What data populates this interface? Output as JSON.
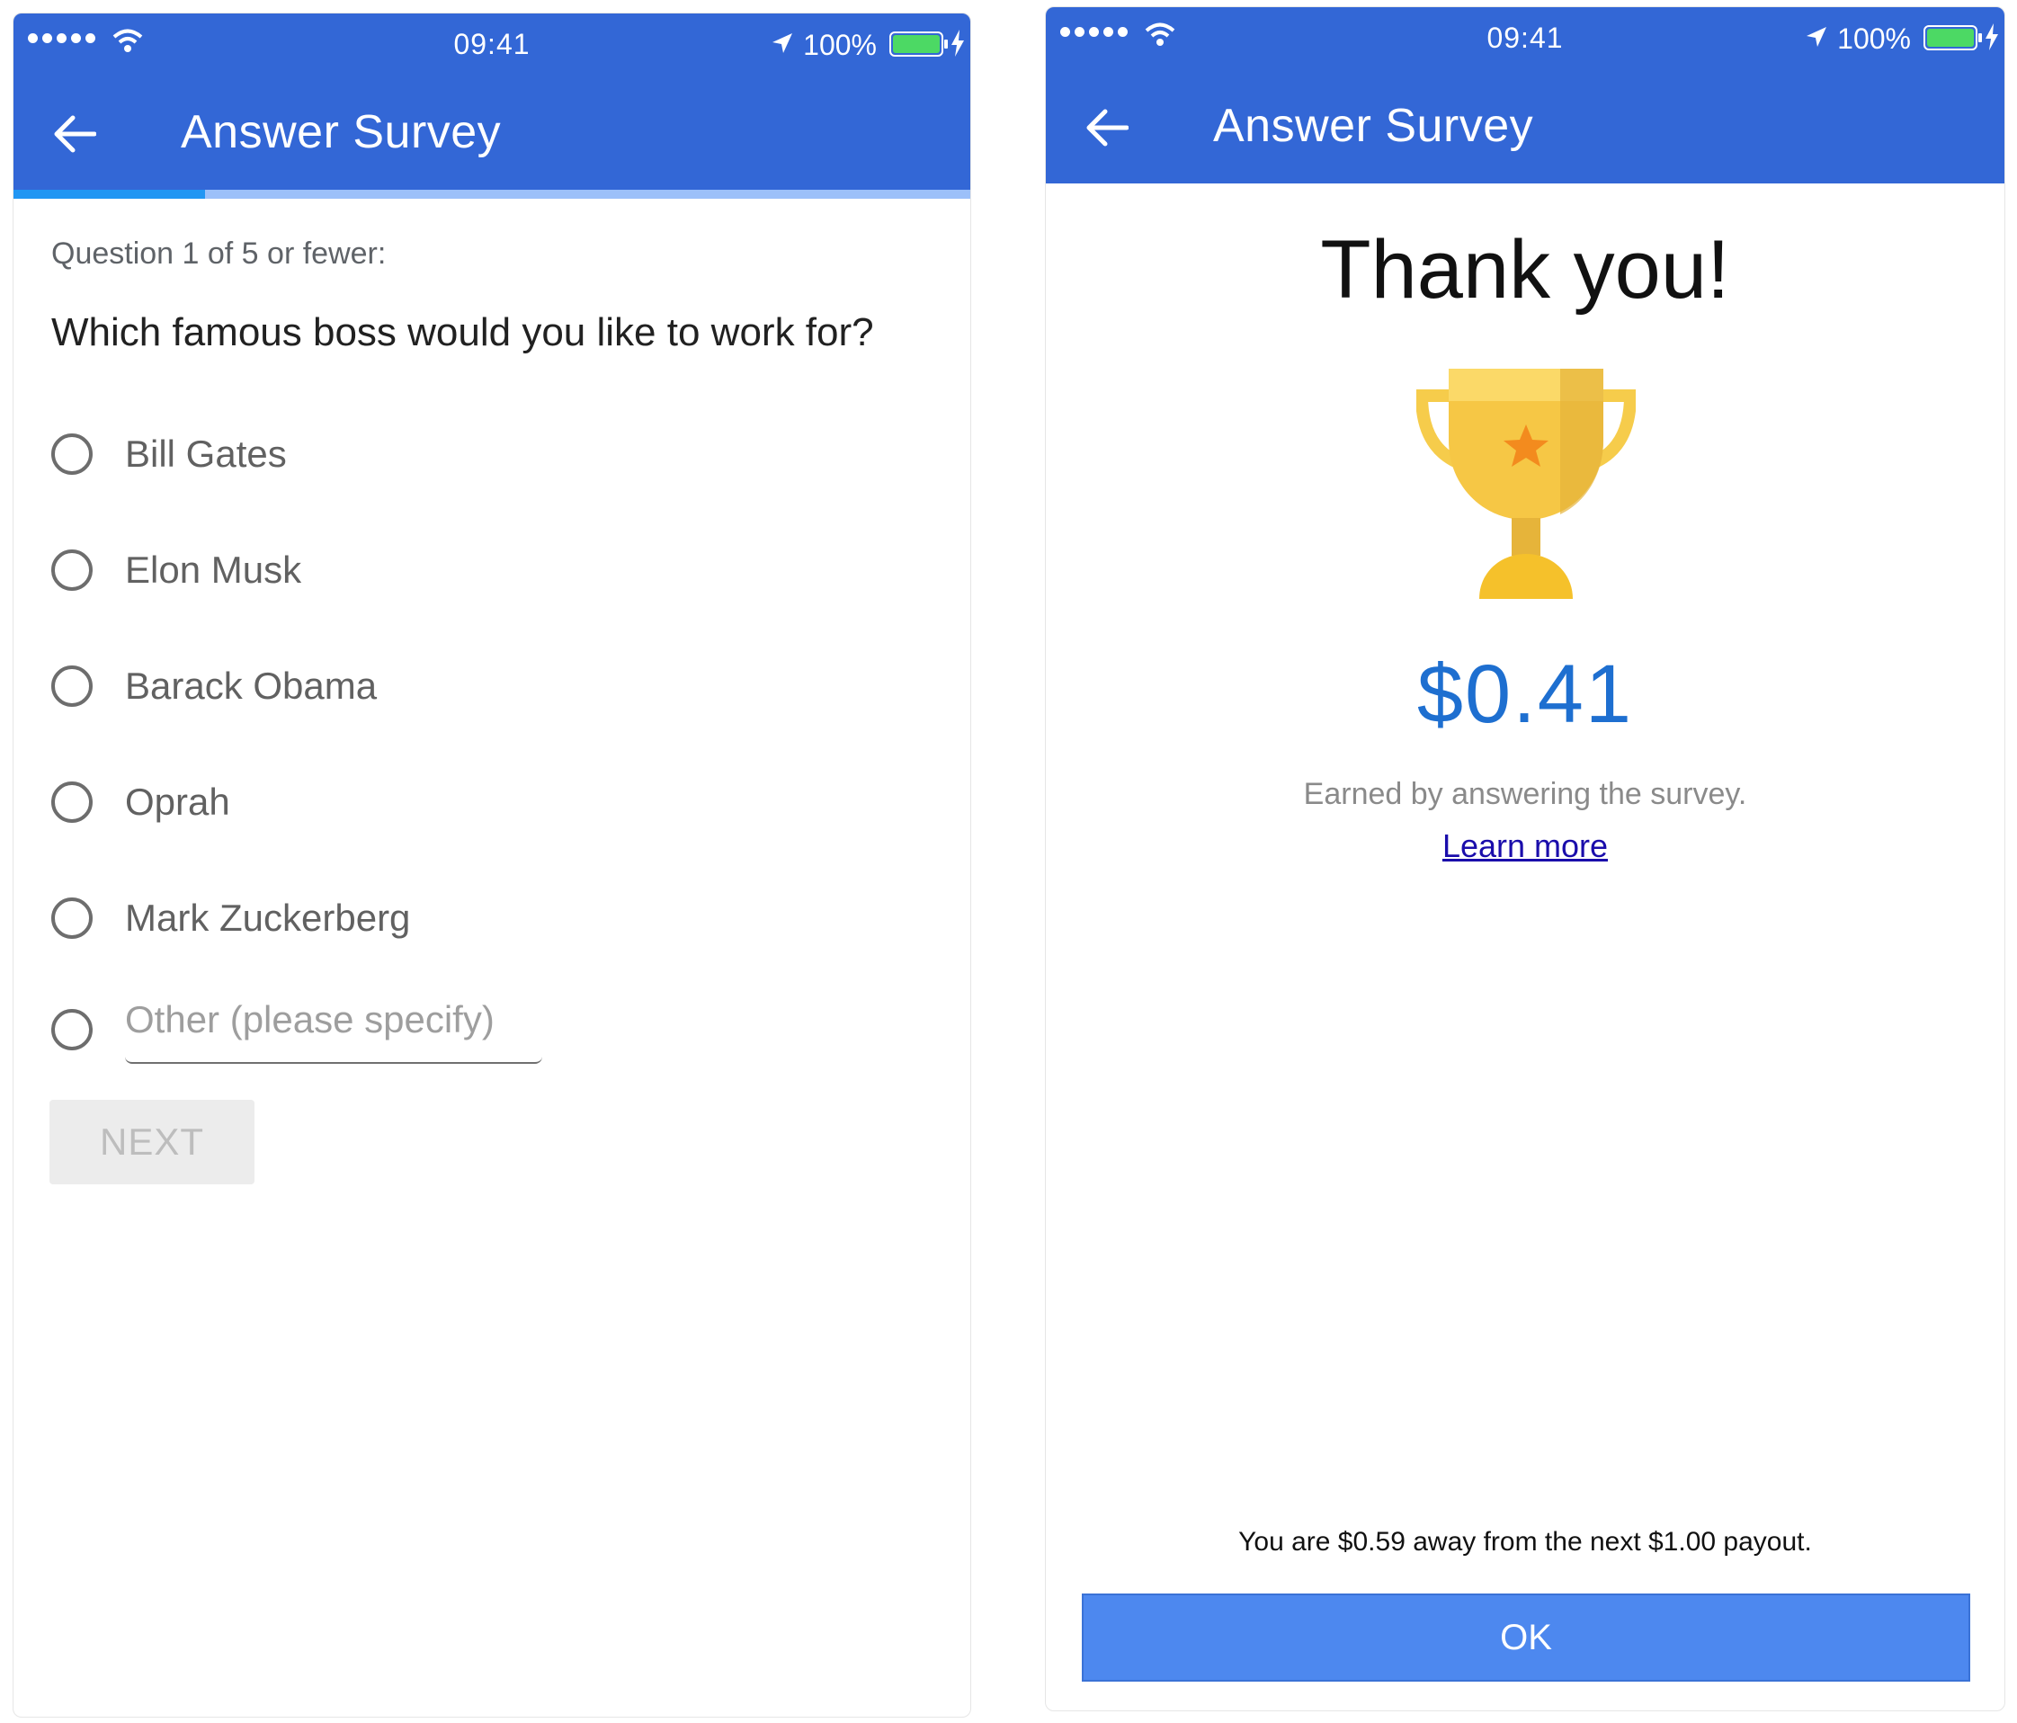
{
  "status_bar": {
    "time": "09:41",
    "battery_percent": "100%",
    "battery_color": "#4cd964"
  },
  "survey_screen": {
    "app_bar": {
      "title": "Answer Survey",
      "back_icon": "arrow-left-icon"
    },
    "progress": {
      "fraction": 0.2
    },
    "question_count": "Question 1 of 5 or fewer:",
    "question": "Which famous boss would you like to work for?",
    "options": [
      {
        "label": "Bill Gates",
        "selected": false
      },
      {
        "label": "Elon Musk",
        "selected": false
      },
      {
        "label": "Barack Obama",
        "selected": false
      },
      {
        "label": "Oprah",
        "selected": false
      },
      {
        "label": "Mark Zuckerberg",
        "selected": false
      }
    ],
    "other_placeholder": "Other (please specify)",
    "next_label": "NEXT"
  },
  "thanks_screen": {
    "app_bar": {
      "title": "Answer Survey",
      "back_icon": "arrow-left-icon"
    },
    "heading": "Thank you!",
    "trophy_icon": "trophy-icon",
    "amount": "$0.41",
    "amount_color": "#1e6fd0",
    "earned_text": "Earned by answering the survey.",
    "learn_more": "Learn more",
    "payout_text": "You are $0.59 away from the next $1.00 payout.",
    "ok_label": "OK"
  },
  "colors": {
    "app_bar": "#3367d6",
    "progress_fill": "#2196f3",
    "progress_track": "#9cc0f9",
    "ok_button": "#4d88ef"
  }
}
